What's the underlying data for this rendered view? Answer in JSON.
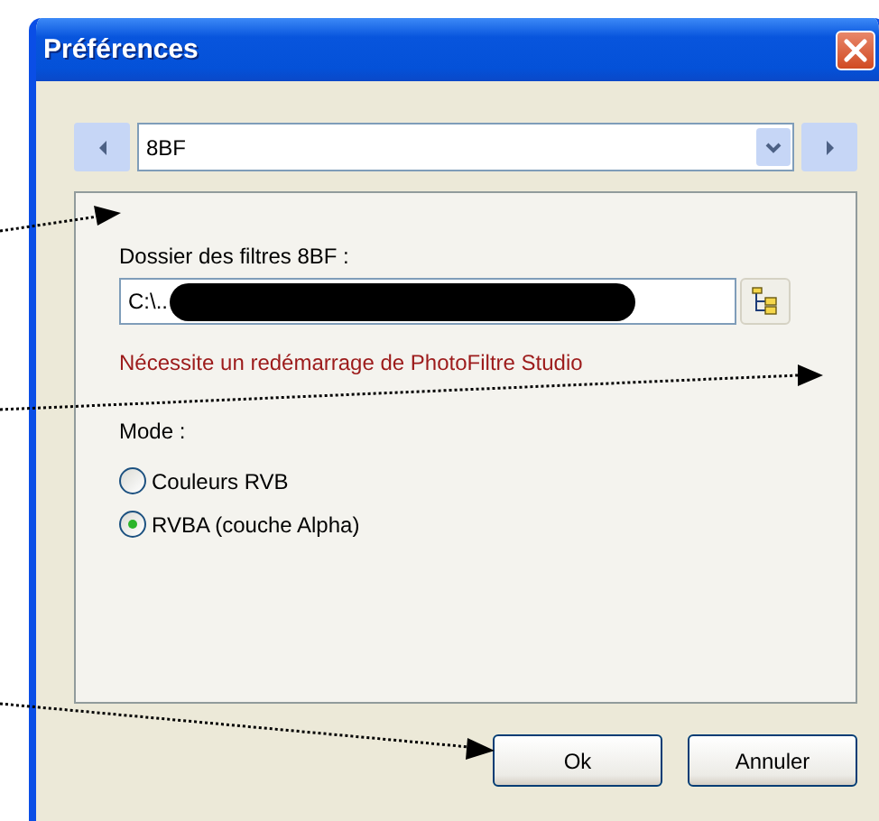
{
  "window": {
    "title": "Préférences"
  },
  "category": {
    "value": "8BF"
  },
  "folder": {
    "label": "Dossier des filtres 8BF :",
    "value": "C:\\.."
  },
  "notice": "Nécessite un redémarrage de PhotoFiltre Studio",
  "mode": {
    "label": "Mode :",
    "options": [
      {
        "label": "Couleurs RVB",
        "selected": false
      },
      {
        "label": "RVBA (couche Alpha)",
        "selected": true
      }
    ]
  },
  "buttons": [
    {
      "label": "Ok"
    },
    {
      "label": "Annuler"
    }
  ]
}
